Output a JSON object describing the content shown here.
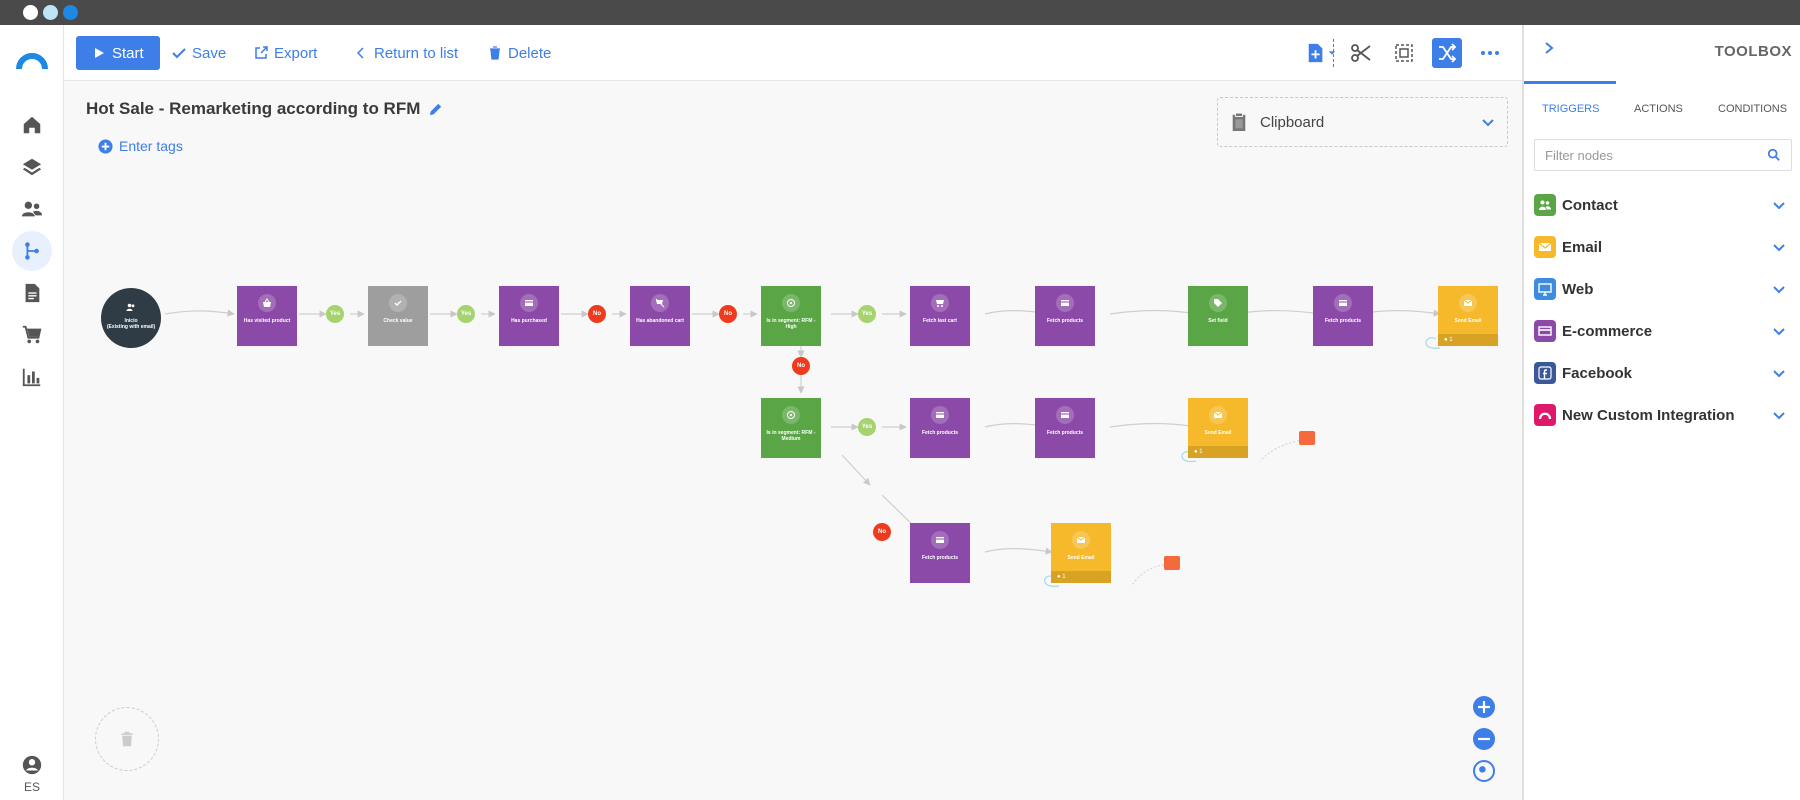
{
  "window": {
    "dot_colors": [
      "#ffffff",
      "#bfe3f7",
      "#1e88e5"
    ]
  },
  "toolbar": {
    "start_label": "Start",
    "save_label": "Save",
    "export_label": "Export",
    "return_label": "Return to list",
    "delete_label": "Delete"
  },
  "canvas": {
    "title": "Hot Sale - Remarketing according to RFM",
    "tags_label": "Enter tags",
    "clipboard_label": "Clipboard"
  },
  "sidebar": {
    "lang": "ES"
  },
  "nodes": {
    "start": "Inicio\n(Existing with email)",
    "n1": "Has visited product",
    "n2": "Check value",
    "n3": "Has purchased",
    "n4": "Has abandoned cart",
    "n5": "Is in segment: RFM - High",
    "n6": "Fetch last cart",
    "n7": "Fetch products",
    "n8": "Set field",
    "n9": "Fetch products",
    "n10": "Send Email",
    "n10_count": "1",
    "m1": "Is in segment: RFM - Medium",
    "m2": "Fetch products",
    "m3": "Fetch products",
    "m4": "Send Email",
    "m4_count": "1",
    "l1": "Fetch products",
    "l2": "Send Email",
    "l2_count": "1"
  },
  "pills": {
    "yes": "Yes",
    "no": "No"
  },
  "toolbox": {
    "title": "TOOLBOX",
    "tabs": [
      "TRIGGERS",
      "ACTIONS",
      "CONDITIONS"
    ],
    "filter_placeholder": "Filter nodes",
    "categories": [
      {
        "label": "Contact",
        "color": "#5aa545",
        "icon": "contacts-icon"
      },
      {
        "label": "Email",
        "color": "#f6b92b",
        "icon": "email-icon"
      },
      {
        "label": "Web",
        "color": "#3d8ce0",
        "icon": "monitor-icon"
      },
      {
        "label": "E-commerce",
        "color": "#8b4aa8",
        "icon": "credit-card-icon"
      },
      {
        "label": "Facebook",
        "color": "#3b5998",
        "icon": "facebook-icon"
      },
      {
        "label": "New Custom Integration",
        "color": "#e0186c",
        "icon": "integration-icon"
      }
    ]
  },
  "colors": {
    "accent": "#3d7ee8",
    "purple": "#8b4aa8",
    "green": "#5aa545",
    "gray": "#9e9e9e",
    "orange": "#f6b92b",
    "yes": "#a5d36e",
    "no": "#ef3b1d",
    "start_node": "#2f3b45"
  }
}
